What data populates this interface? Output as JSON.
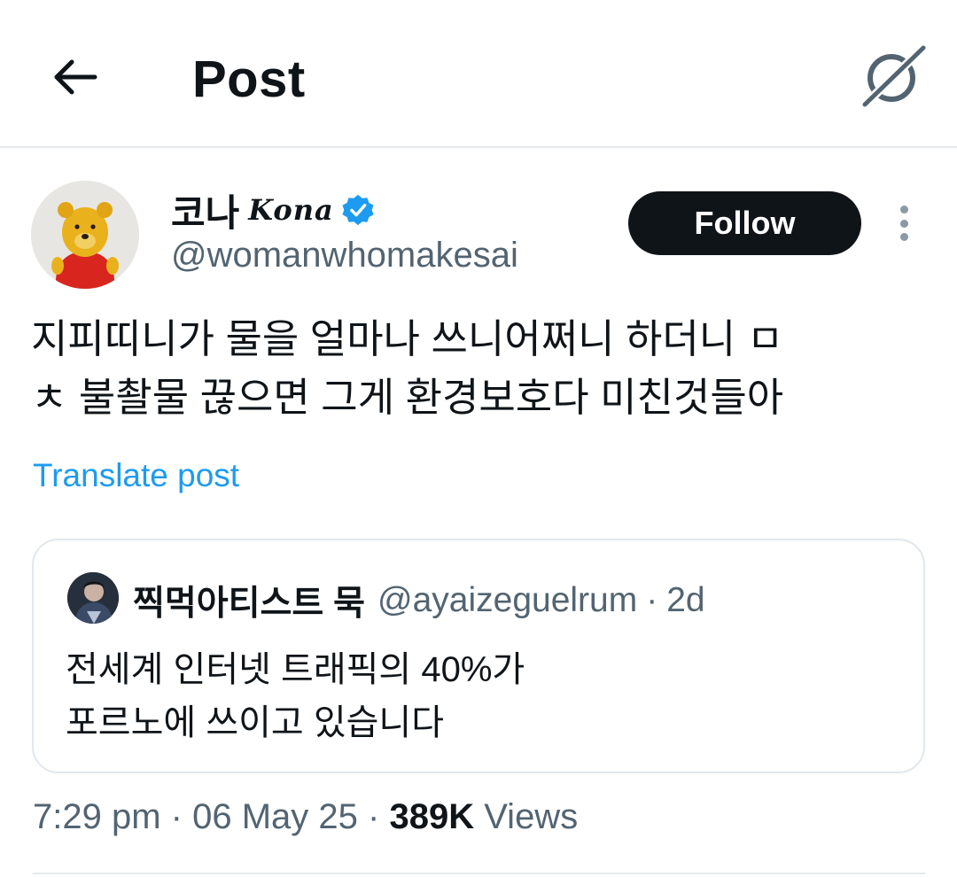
{
  "header": {
    "title": "Post",
    "back_icon": "arrow-left-icon",
    "grok_icon": "grok-icon"
  },
  "author": {
    "display_name": "코나",
    "name_script": "Kona",
    "handle": "@womanwhomakesai",
    "verified_color": "#1d9bf0",
    "follow_label": "Follow"
  },
  "post": {
    "text_line1": "지피띠니가 물을 얼마나 쓰니어쩌니 하더니 ㅁ",
    "text_line2": "ㅊ 불촬물 끊으면 그게 환경보호다 미친것들아",
    "translate_label": "Translate post"
  },
  "quote": {
    "display_name": "찍먹아티스트 묵",
    "handle": "@ayaizeguelrum",
    "separator": "·",
    "time": "2d",
    "text_line1": "전세계 인터넷 트래픽의 40%가",
    "text_line2": "포르노에 쓰이고 있습니다"
  },
  "meta": {
    "time": "7:29 pm",
    "separator": "·",
    "date": "06 May 25",
    "views_count": "389K",
    "views_label": "Views"
  },
  "colors": {
    "text": "#0f1419",
    "secondary": "#536471",
    "link": "#1d9bf0",
    "border": "#e1e8ed"
  }
}
